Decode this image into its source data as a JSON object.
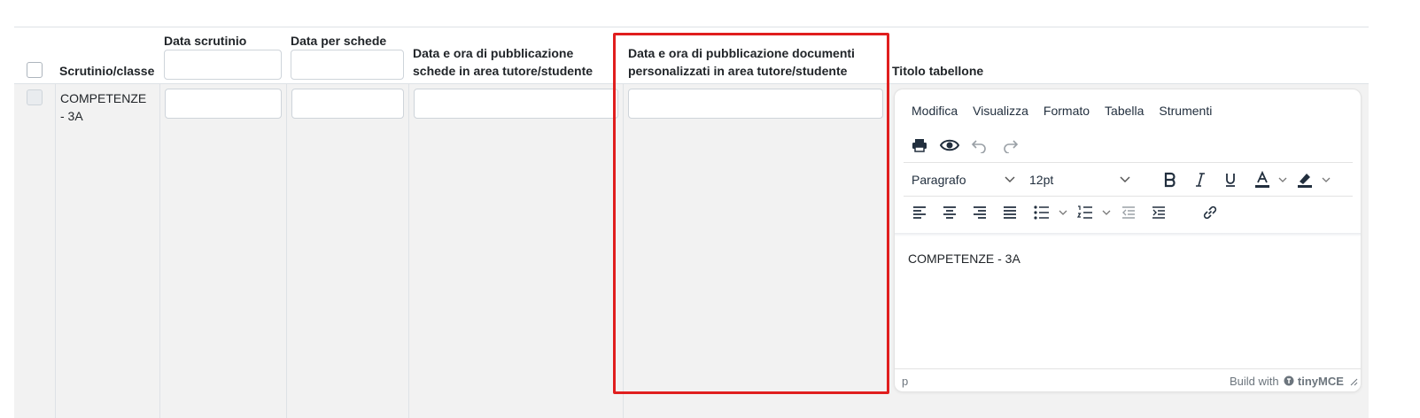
{
  "columns": {
    "scrutinio_classe": "Scrutinio/classe",
    "data_scrutinio": "Data scrutinio",
    "data_per_schede": "Data per schede",
    "pub_schede": "Data e ora di pubblicazione schede in area tutore/studente",
    "pub_documenti": "Data e ora di pubblicazione documenti personalizzati in area tutore/studente",
    "titolo_tabellone": "Titolo tabellone"
  },
  "row": {
    "classe": "COMPETENZE - 3A",
    "data_scrutinio": "",
    "data_per_schede": "",
    "pub_schede": "",
    "pub_documenti": ""
  },
  "editor": {
    "menu": [
      "Modifica",
      "Visualizza",
      "Formato",
      "Tabella",
      "Strumenti"
    ],
    "block_format": "Paragrafo",
    "font_size": "12pt",
    "content": "COMPETENZE - 3A",
    "status_path": "p",
    "branding_prefix": "Build with",
    "branding_name": "tinyMCE"
  },
  "colors": {
    "highlight_border": "#e01e1e",
    "row_background": "#f2f2f2"
  }
}
